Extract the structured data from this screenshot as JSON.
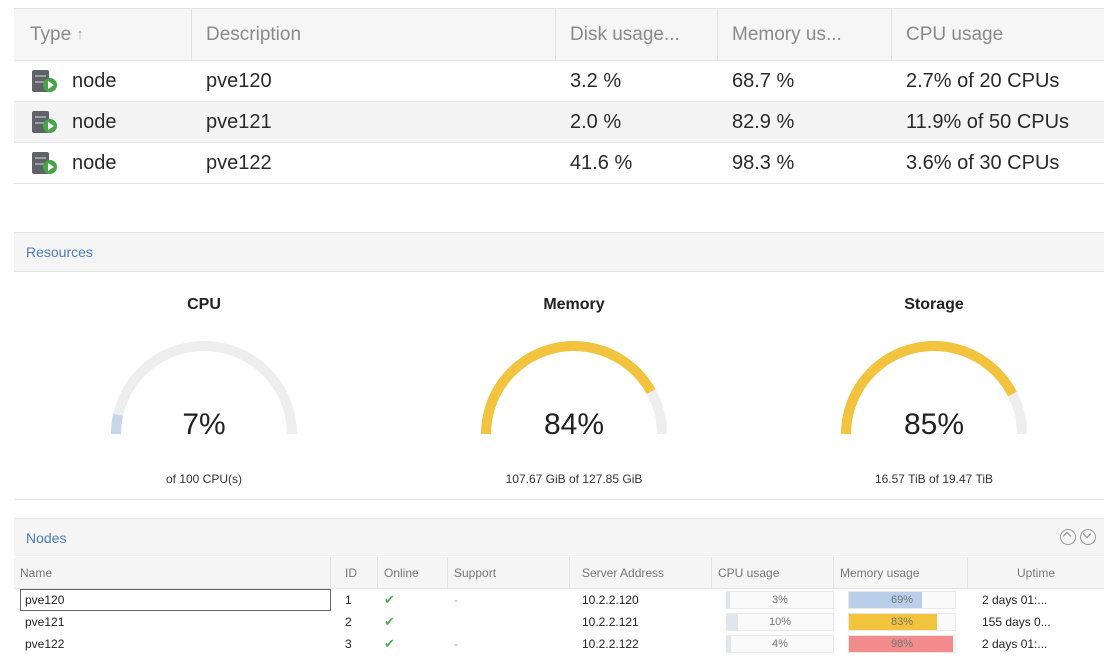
{
  "resource_grid": {
    "columns": {
      "type": "Type",
      "sort_arrow": "↑",
      "description": "Description",
      "disk": "Disk usage...",
      "memory": "Memory us...",
      "cpu": "CPU usage"
    },
    "rows": [
      {
        "type": "node",
        "description": "pve120",
        "disk": "3.2 %",
        "memory": "68.7 %",
        "cpu": "2.7% of 20 CPUs"
      },
      {
        "type": "node",
        "description": "pve121",
        "disk": "2.0 %",
        "memory": "82.9 %",
        "cpu": "11.9% of 50 CPUs"
      },
      {
        "type": "node",
        "description": "pve122",
        "disk": "41.6 %",
        "memory": "98.3 %",
        "cpu": "3.6% of 30 CPUs"
      }
    ]
  },
  "resources": {
    "title": "Resources",
    "gauges": [
      {
        "title": "CPU",
        "value": "7%",
        "fraction": 0.07,
        "subtext": "of 100 CPU(s)",
        "color": "#c6d7ec"
      },
      {
        "title": "Memory",
        "value": "84%",
        "fraction": 0.84,
        "subtext": "107.67 GiB of 127.85 GiB",
        "color": "#f2c33c"
      },
      {
        "title": "Storage",
        "value": "85%",
        "fraction": 0.85,
        "subtext": "16.57 TiB of 19.47 TiB",
        "color": "#f2c33c"
      }
    ],
    "track_color": "#eeeeee"
  },
  "nodes": {
    "title": "Nodes",
    "columns": {
      "name": "Name",
      "id": "ID",
      "online": "Online",
      "support": "Support",
      "address": "Server Address",
      "cpu": "CPU usage",
      "memory": "Memory usage",
      "uptime": "Uptime"
    },
    "rows": [
      {
        "name": "pve120",
        "id": "1",
        "online": "✔",
        "support": "-",
        "address": "10.2.2.120",
        "cpu": "3%",
        "cpu_fraction": 0.03,
        "memory": "69%",
        "mem_fraction": 0.69,
        "mem_color": "#b9cfe9",
        "uptime": "2 days 01:...",
        "selected": true
      },
      {
        "name": "pve121",
        "id": "2",
        "online": "✔",
        "support": "",
        "address": "10.2.2.121",
        "cpu": "10%",
        "cpu_fraction": 0.1,
        "memory": "83%",
        "mem_fraction": 0.83,
        "mem_color": "#f2c33c",
        "uptime": "155 days 0...",
        "selected": false
      },
      {
        "name": "pve122",
        "id": "3",
        "online": "✔",
        "support": "-",
        "address": "10.2.2.122",
        "cpu": "4%",
        "cpu_fraction": 0.04,
        "memory": "98%",
        "mem_fraction": 0.98,
        "mem_color": "#f28b8b",
        "uptime": "2 days 01:...",
        "selected": false
      }
    ]
  }
}
